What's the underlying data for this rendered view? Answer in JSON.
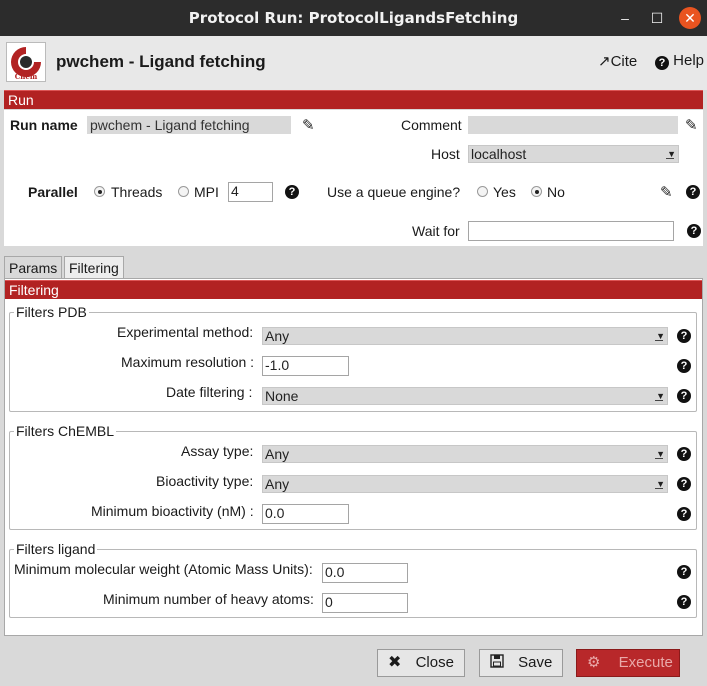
{
  "window": {
    "title": "Protocol Run: ProtocolLigandsFetching",
    "minimize_glyph": "–",
    "maximize_glyph": "☐",
    "close_glyph": "✕"
  },
  "header": {
    "logo_text": "Chem",
    "title": "pwchem - Ligand fetching",
    "cite_label": "Cite",
    "help_label": "Help"
  },
  "run": {
    "section_label": "Run",
    "run_name_label": "Run name",
    "run_name_value": "pwchem - Ligand fetching",
    "comment_label": "Comment",
    "comment_value": "",
    "host_label": "Host",
    "host_value": "localhost",
    "parallel_label": "Parallel",
    "threads_label": "Threads",
    "mpi_label": "MPI",
    "threads_value": "4",
    "queue_label": "Use a queue engine?",
    "yes_label": "Yes",
    "no_label": "No",
    "wait_for_label": "Wait for",
    "wait_for_value": ""
  },
  "tabs": [
    {
      "label": "Params"
    },
    {
      "label": "Filtering"
    }
  ],
  "filtering": {
    "section_label": "Filtering",
    "pdb": {
      "legend": "Filters PDB",
      "exp_method_label": "Experimental method:",
      "exp_method_value": "Any",
      "max_res_label": "Maximum resolution :",
      "max_res_value": "-1.0",
      "date_label": "Date filtering :",
      "date_value": "None"
    },
    "chembl": {
      "legend": "Filters ChEMBL",
      "assay_label": "Assay type:",
      "assay_value": "Any",
      "bioact_label": "Bioactivity type:",
      "bioact_value": "Any",
      "min_bioact_label": "Minimum bioactivity (nM) :",
      "min_bioact_value": "0.0"
    },
    "ligand": {
      "legend": "Filters ligand",
      "min_mw_label": "Minimum molecular weight (Atomic Mass Units):",
      "min_mw_value": "0.0",
      "min_heavy_label": "Minimum number of heavy atoms:",
      "min_heavy_value": "0"
    }
  },
  "footer": {
    "close_label": "Close",
    "save_label": "Save",
    "execute_label": "Execute"
  },
  "help_glyph": "?",
  "colors": {
    "accent": "#b22222",
    "titlebar": "#2c2c2c",
    "close_button": "#e95420"
  }
}
